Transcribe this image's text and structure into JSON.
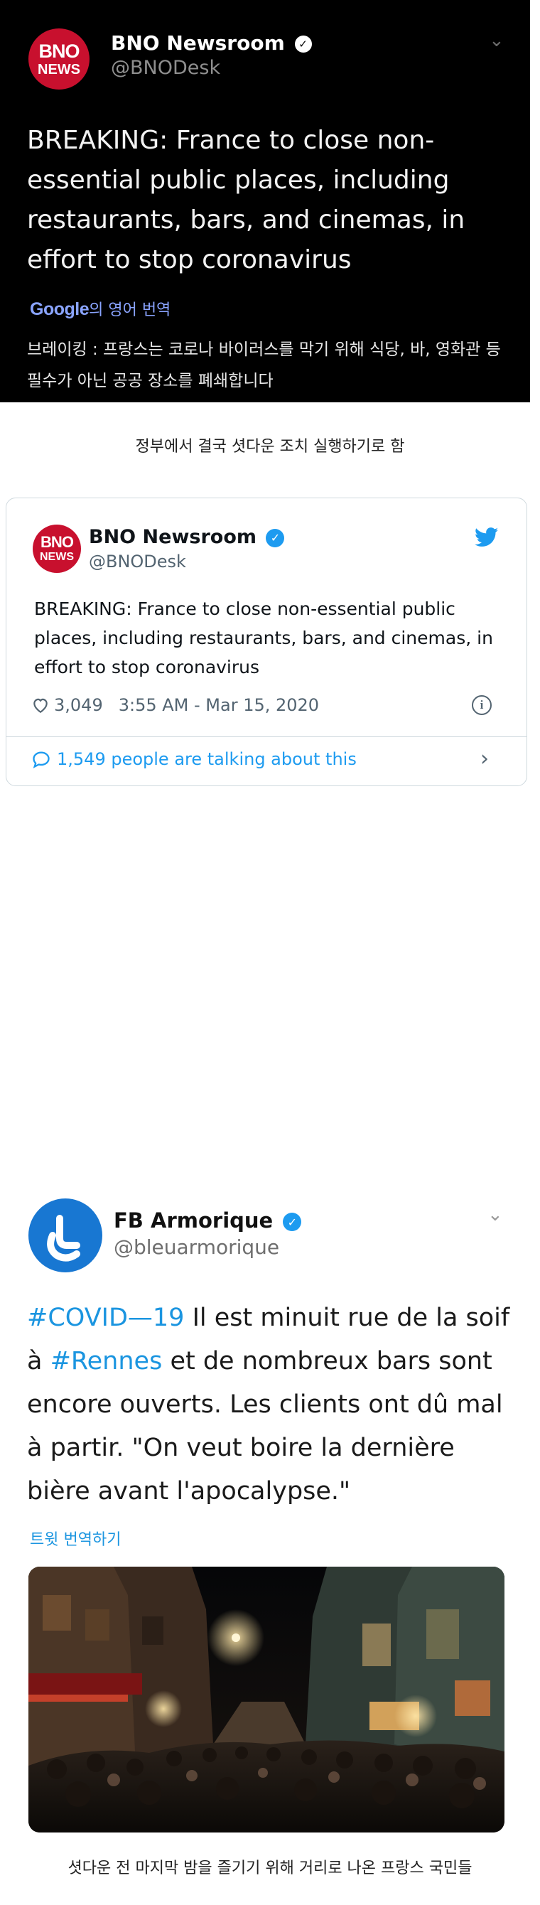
{
  "dark_tweet": {
    "logo_top": "BNO",
    "logo_bottom": "NEWS",
    "display_name": "BNO Newsroom",
    "handle": "@BNODesk",
    "body": "BREAKING: France to close non-essential public places, including restaurants, bars, and cinemas, in effort to stop coronavirus",
    "translate_brand": "Google",
    "translate_suffix": "의 영어 번역",
    "translation": "브레이킹 : 프랑스는 코로나 바이러스를 막기 위해 식당, 바, 영화관 등 필수가 아닌 공공 장소를 폐쇄합니다"
  },
  "caption_1": "정부에서 결국 셧다운 조치 실행하기로 함",
  "embed_tweet": {
    "logo_top": "BNO",
    "logo_bottom": "NEWS",
    "display_name": "BNO Newsroom",
    "handle": "@BNODesk",
    "body": "BREAKING: France to close non-essential public places, including restaurants, bars, and cinemas, in effort to stop coronavirus",
    "likes": "3,049",
    "timestamp": "3:55 AM - Mar 15, 2020",
    "talking": "1,549 people are talking about this"
  },
  "fb_tweet": {
    "display_name": "FB Armorique",
    "handle": "@bleuarmorique",
    "hashtag_1": "#COVID—19",
    "text_1": " Il est minuit rue de la soif à ",
    "hashtag_2": "#Rennes",
    "text_2": " et de nombreux bars sont encore ouverts. Les clients ont dû mal à partir. \"On veut boire la dernière bière avant l'apocalypse.\"",
    "translate": "트윗 번역하기"
  },
  "caption_2": "셧다운 전 마지막 밤을 즐기기 위해 거리로 나온 프랑스 국민들",
  "colors": {
    "bno_red": "#c8102e",
    "twitter_blue": "#1d9bf0",
    "fb_blue": "#1877d2"
  },
  "icons": {
    "verified": "verified-badge-icon",
    "chevron": "chevron-down-icon",
    "bird": "twitter-bird-icon",
    "heart": "heart-icon",
    "info": "info-icon",
    "comment": "comment-bubble-icon",
    "arrow": "chevron-right-icon"
  }
}
